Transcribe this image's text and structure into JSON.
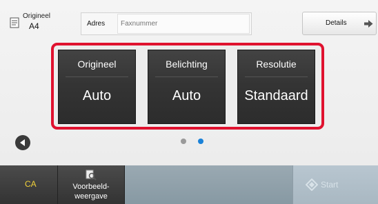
{
  "header": {
    "original_label": "Origineel",
    "original_size": "A4",
    "address_label": "Adres",
    "fax_placeholder": "Faxnummer",
    "details_label": "Details"
  },
  "settings": [
    {
      "title": "Origineel",
      "value": "Auto"
    },
    {
      "title": "Belichting",
      "value": "Auto"
    },
    {
      "title": "Resolutie",
      "value": "Standaard"
    }
  ],
  "pagination": {
    "page_count": 2,
    "active_page": 2
  },
  "footer": {
    "ca_label": "CA",
    "preview_label_line1": "Voorbeeld-",
    "preview_label_line2": "weergave",
    "start_label": "Start"
  },
  "colors": {
    "highlight_border": "#e0122f",
    "active_dot": "#1a82d8",
    "ca_text": "#f2d23a"
  }
}
